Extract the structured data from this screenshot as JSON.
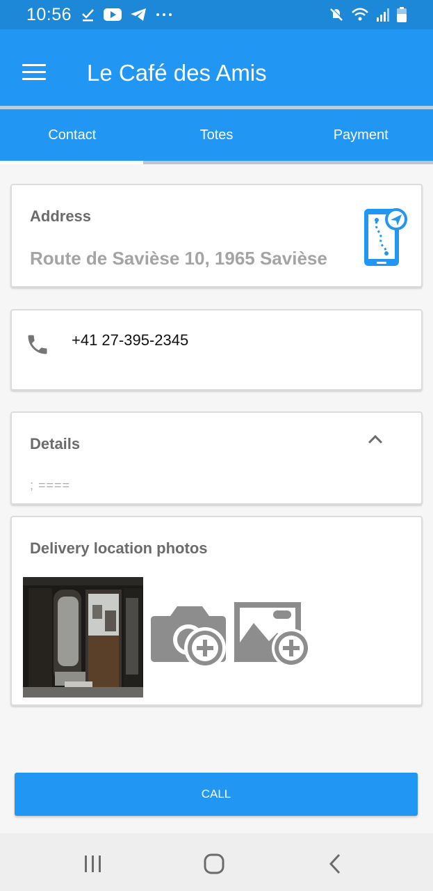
{
  "status_bar": {
    "time": "10:56",
    "notification_icons": [
      "check-icon",
      "youtube-icon",
      "telegram-icon",
      "more-dots-icon"
    ],
    "system_icons": [
      "mute-icon",
      "wifi-icon",
      "signal-icon",
      "battery-icon"
    ]
  },
  "app_bar": {
    "title": "Le Café des Amis",
    "menu_icon": "hamburger-menu-icon"
  },
  "tabs": [
    {
      "label": "Contact",
      "selected": true
    },
    {
      "label": "Totes",
      "selected": false
    },
    {
      "label": "Payment",
      "selected": false
    }
  ],
  "address_card": {
    "title": "Address",
    "value": "Route de Savièse 10, 1965 Savièse",
    "icon": "phone-navigation-icon"
  },
  "phone_card": {
    "number": "+41 27-395-2345",
    "icon": "phone-icon"
  },
  "details_card": {
    "title": "Details",
    "note": "; ====",
    "icon": "chevron-up-icon"
  },
  "photos_card": {
    "title": "Delivery location photos",
    "photo": "storefront-door-photo",
    "add_icons": [
      "add-camera-photo-icon",
      "add-gallery-photo-icon"
    ]
  },
  "call_button": {
    "label": "CALL"
  },
  "nav_bar": {
    "icons": [
      "recent-apps-icon",
      "home-icon",
      "back-icon"
    ]
  },
  "colors": {
    "primary": "#2196f3",
    "status_bar": "#1e88d8",
    "icon_grey": "#8d8d8d"
  }
}
